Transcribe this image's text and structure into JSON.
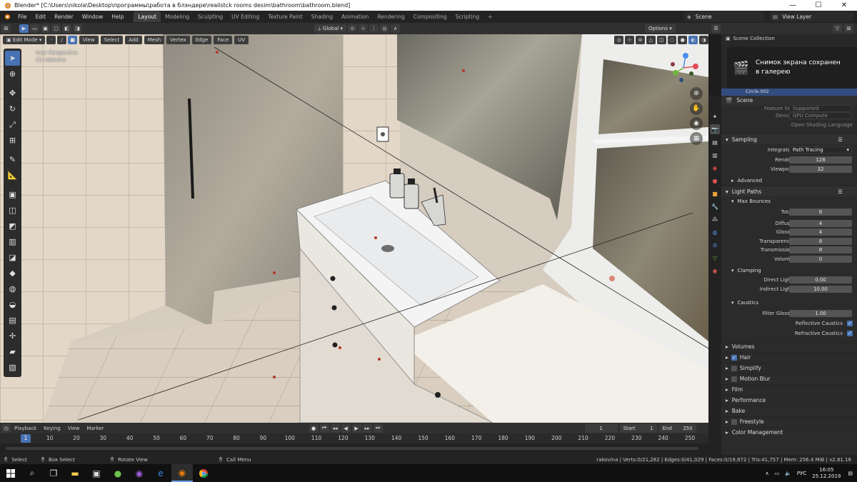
{
  "window": {
    "title": "Blender* [C:\\Users\\nikola\\Desktop\\программы\\работа в блэндере\\realistck rooms desim\\bathroom\\bathroom.blend]",
    "min": "—",
    "max": "☐",
    "close": "✕"
  },
  "menu": [
    "File",
    "Edit",
    "Render",
    "Window",
    "Help"
  ],
  "workspaces": [
    "Layout",
    "Modeling",
    "Sculpting",
    "UV Editing",
    "Texture Paint",
    "Shading",
    "Animation",
    "Rendering",
    "Compositing",
    "Scripting"
  ],
  "workspace_add": "+",
  "scene_name": "Scene",
  "view_layer": "View Layer",
  "viewport_header": {
    "mode": "Edit Mode",
    "menus": [
      "View",
      "Select",
      "Add",
      "Mesh",
      "Vertex",
      "Edge",
      "Face",
      "UV"
    ],
    "orientation": "Global",
    "options": "Options"
  },
  "viewport_info": {
    "line1": "User Perspective",
    "line2": "(1) rakovina"
  },
  "outliner": {
    "title": "Scene Collection",
    "row": "Circle.002"
  },
  "toast": {
    "line1": "Снимок экрана сохранен",
    "line2": "в галерею"
  },
  "properties": {
    "header": "Scene",
    "device_label": "Device",
    "device_value": "GPU Compute",
    "osl_label": "Open Shading Language",
    "feature_set_label": "Feature Set",
    "feature_set_value": "Supported",
    "sampling": {
      "title": "Sampling",
      "integrator_label": "Integrator",
      "integrator_value": "Path Tracing",
      "render_label": "Render",
      "render_value": "128",
      "viewport_label": "Viewport",
      "viewport_value": "32",
      "advanced": "Advanced"
    },
    "light_paths": {
      "title": "Light Paths",
      "max_bounces": "Max Bounces",
      "total_label": "Total",
      "total_value": "8",
      "diffuse_label": "Diffuse",
      "diffuse_value": "4",
      "glossy_label": "Glossy",
      "glossy_value": "4",
      "transparency_label": "Transparency",
      "transparency_value": "8",
      "transmission_label": "Transmission",
      "transmission_value": "8",
      "volume_label": "Volume",
      "volume_value": "0",
      "clamping": "Clamping",
      "direct_label": "Direct Light",
      "direct_value": "0.00",
      "indirect_label": "Indirect Light",
      "indirect_value": "10.00",
      "caustics": "Caustics",
      "filter_label": "Filter Glossy",
      "filter_value": "1.00",
      "reflective_label": "Reflective Caustics",
      "refractive_label": "Refractive Caustics"
    },
    "volumes": "Volumes",
    "hair": "Hair",
    "simplify": "Simplify",
    "motion_blur": "Motion Blur",
    "film": "Film",
    "performance": "Performance",
    "bake": "Bake",
    "freestyle": "Freestyle",
    "color_management": "Color Management"
  },
  "timeline": {
    "menus": [
      "Playback",
      "Keying",
      "View",
      "Marker"
    ],
    "current_frame": "1",
    "start_label": "Start",
    "start_value": "1",
    "end_label": "End",
    "end_value": "250",
    "ticks": [
      "1",
      "10",
      "20",
      "30",
      "40",
      "50",
      "60",
      "70",
      "80",
      "90",
      "100",
      "110",
      "120",
      "130",
      "140",
      "150",
      "160",
      "170",
      "180",
      "190",
      "200",
      "210",
      "220",
      "230",
      "240",
      "250"
    ]
  },
  "statusbar": {
    "select": "Select",
    "box_select": "Box Select",
    "rotate_view": "Rotate View",
    "call_menu": "Call Menu",
    "stats": "rakovina | Verts:0/21,282 | Edges:0/41,029 | Faces:0/19,872 | Tris:41,757 | Mem: 256.4 MiB | v2.81.16"
  },
  "taskbar": {
    "lang": "РУС",
    "time": "16:05",
    "date": "25.12.2019"
  },
  "colors": {
    "accent": "#4772b3",
    "active_tab": "#3d3d3d",
    "panel": "#2b2b2b"
  }
}
